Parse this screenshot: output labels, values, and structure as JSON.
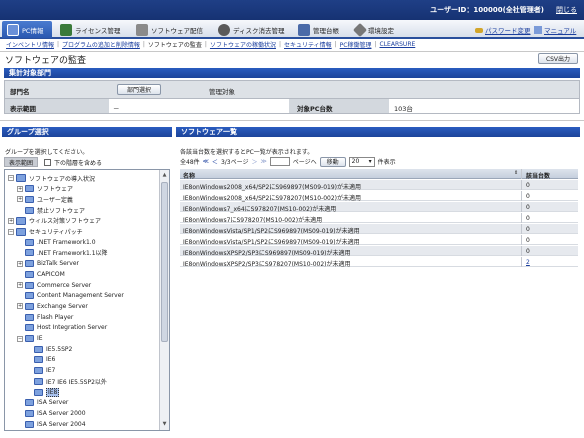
{
  "header": {
    "user_label": "ユーザーID：100000(全社管理者)",
    "close_label": "閉じる"
  },
  "menu": {
    "items": [
      {
        "label": "PC情報",
        "icon": "pc-icon"
      },
      {
        "label": "ライセンス管理",
        "icon": "license-icon"
      },
      {
        "label": "ソフトウェア配信",
        "icon": "software-delivery-icon"
      },
      {
        "label": "ディスク消去管理",
        "icon": "disk-icon"
      },
      {
        "label": "管理台帳",
        "icon": "ledger-icon"
      },
      {
        "label": "環境設定",
        "icon": "settings-icon"
      }
    ],
    "password_change": "パスワード変更",
    "manual": "マニュアル"
  },
  "submenu": {
    "items": [
      "インベントリ情報",
      "プログラムの追加と削除情報",
      "ソフトウェアの監査",
      "ソフトウェアの稼働状況",
      "セキュリティ情報",
      "PC稼働管理",
      "CLEARSURE"
    ]
  },
  "page": {
    "title": "ソフトウェアの監査",
    "csv_button": "CSV出力"
  },
  "dept_section": {
    "header": "集計対象部門",
    "dept_label": "部門名",
    "dept_select_button": "部門選択",
    "dept_value": "管理対象",
    "range_label": "表示範囲",
    "range_value": "－",
    "pc_count_label": "対象PC台数",
    "pc_count_value": "103台"
  },
  "group_panel": {
    "header": "グループ選択",
    "instruction": "グループを選択してください。",
    "range_label": "表示範囲",
    "lower_layer_label": "下の階層を含める",
    "tree": [
      {
        "label": "ソフトウェアの導入状況",
        "level": 0,
        "toggle": "−",
        "folder": true
      },
      {
        "label": "ソフトウェア",
        "level": 1,
        "toggle": "+",
        "folder": true
      },
      {
        "label": "ユーザー定義",
        "level": 1,
        "toggle": "+",
        "folder": true
      },
      {
        "label": "禁止ソフトウェア",
        "level": 1,
        "toggle": "",
        "folder": true
      },
      {
        "label": "ウィルス対策ソフトウェア",
        "level": 0,
        "toggle": "+",
        "folder": true
      },
      {
        "label": "セキュリティパッチ",
        "level": 0,
        "toggle": "−",
        "folder": true
      },
      {
        "label": ".NET Framework1.0",
        "level": 1,
        "toggle": "",
        "folder": true
      },
      {
        "label": ".NET Framework1.1以降",
        "level": 1,
        "toggle": "",
        "folder": true
      },
      {
        "label": "BizTalk Server",
        "level": 1,
        "toggle": "+",
        "folder": true
      },
      {
        "label": "CAPICOM",
        "level": 1,
        "toggle": "",
        "folder": true
      },
      {
        "label": "Commerce Server",
        "level": 1,
        "toggle": "+",
        "folder": true
      },
      {
        "label": "Content Management Server",
        "level": 1,
        "toggle": "",
        "folder": true
      },
      {
        "label": "Exchange Server",
        "level": 1,
        "toggle": "+",
        "folder": true
      },
      {
        "label": "Flash Player",
        "level": 1,
        "toggle": "",
        "folder": true
      },
      {
        "label": "Host Integration Server",
        "level": 1,
        "toggle": "",
        "folder": true
      },
      {
        "label": "IE",
        "level": 1,
        "toggle": "−",
        "folder": true
      },
      {
        "label": "IE5.5SP2",
        "level": 2,
        "toggle": "",
        "folder": true
      },
      {
        "label": "IE6",
        "level": 2,
        "toggle": "",
        "folder": true
      },
      {
        "label": "IE7",
        "level": 2,
        "toggle": "",
        "folder": true
      },
      {
        "label": "IE7 IE6 IE5.5SP2以外",
        "level": 2,
        "toggle": "",
        "folder": true
      },
      {
        "label": "IE8",
        "level": 2,
        "toggle": "",
        "folder": true,
        "selected": true
      },
      {
        "label": "ISA Server",
        "level": 1,
        "toggle": "",
        "folder": true
      },
      {
        "label": "ISA Server 2000",
        "level": 1,
        "toggle": "",
        "folder": true
      },
      {
        "label": "ISA Server 2004",
        "level": 1,
        "toggle": "",
        "folder": true
      }
    ]
  },
  "software_panel": {
    "header": "ソフトウェア一覧",
    "instruction": "各該当台数を選択するとPC一覧が表示されます。",
    "pager": {
      "total": "全48件",
      "first": "≪",
      "prev": "＜",
      "page_info": "3/3ページ",
      "next": "＞",
      "last": "≫",
      "page_label": "ページへ",
      "move_button": "移動",
      "per_page": "20",
      "per_page_label": "件表示"
    },
    "columns": {
      "name": "名称",
      "count": "該当台数"
    },
    "rows": [
      {
        "name": "IE8onWindows2008_x64/SP2にS969897(MS09-019)が未適用",
        "count": "0",
        "link": false
      },
      {
        "name": "IE8onWindows2008_x64/SP2にS978207(MS10-002)が未適用",
        "count": "0",
        "link": false
      },
      {
        "name": "IE8onWindows7_x64にS978207(MS10-002)が未適用",
        "count": "0",
        "link": false
      },
      {
        "name": "IE8onWindows7にS978207(MS10-002)が未適用",
        "count": "0",
        "link": false
      },
      {
        "name": "IE8onWindowsVista/SP1/SP2にS969897(MS09-019)が未適用",
        "count": "0",
        "link": false
      },
      {
        "name": "IE8onWindowsVista/SP1/SP2にS969897(MS09-019)が未適用",
        "count": "0",
        "link": false
      },
      {
        "name": "IE8onWindowsXPSP2/SP3にS969897(MS09-019)が未適用",
        "count": "0",
        "link": false
      },
      {
        "name": "IE8onWindowsXPSP2/SP3にS978207(MS10-002)が未適用",
        "count": "2",
        "link": true
      }
    ]
  }
}
